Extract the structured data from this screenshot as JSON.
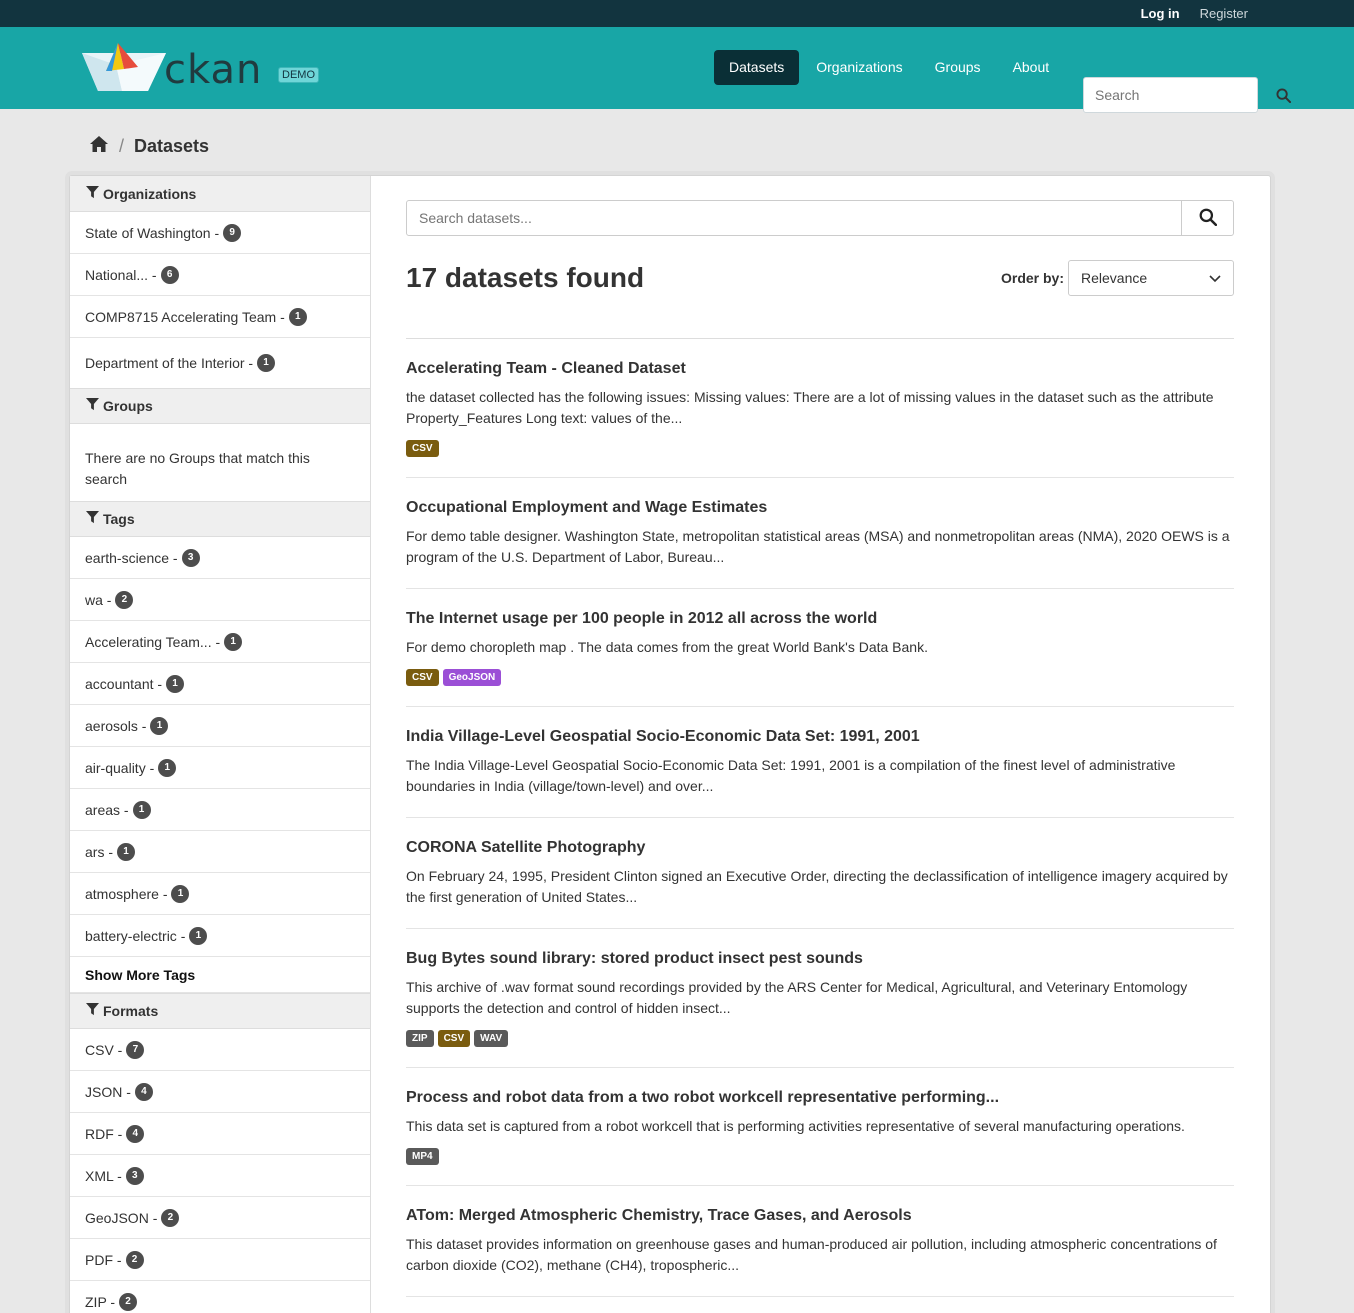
{
  "account": {
    "login": "Log in",
    "register": "Register"
  },
  "brand": {
    "name": "ckan",
    "badge": "DEMO"
  },
  "nav": {
    "items": [
      {
        "label": "Datasets",
        "active": true
      },
      {
        "label": "Organizations"
      },
      {
        "label": "Groups"
      },
      {
        "label": "About"
      }
    ],
    "search_placeholder": "Search"
  },
  "breadcrumb": {
    "current": "Datasets",
    "separator": "/"
  },
  "sidebar": {
    "organizations": {
      "heading": "Organizations",
      "items": [
        {
          "label": "State of Washington -",
          "count": "9"
        },
        {
          "label": "National... -",
          "count": "6"
        },
        {
          "label": "COMP8715 Accelerating Team -",
          "count": "1"
        },
        {
          "label": "Department of the Interior -",
          "count": "1"
        }
      ]
    },
    "groups": {
      "heading": "Groups",
      "empty": "There are no Groups that match this search"
    },
    "tags": {
      "heading": "Tags",
      "items": [
        {
          "label": "earth-science -",
          "count": "3"
        },
        {
          "label": "wa -",
          "count": "2"
        },
        {
          "label": "Accelerating Team... -",
          "count": "1"
        },
        {
          "label": "accountant -",
          "count": "1"
        },
        {
          "label": "aerosols -",
          "count": "1"
        },
        {
          "label": "air-quality -",
          "count": "1"
        },
        {
          "label": "areas -",
          "count": "1"
        },
        {
          "label": "ars -",
          "count": "1"
        },
        {
          "label": "atmosphere -",
          "count": "1"
        },
        {
          "label": "battery-electric -",
          "count": "1"
        }
      ],
      "show_more": "Show More Tags"
    },
    "formats": {
      "heading": "Formats",
      "items": [
        {
          "label": "CSV -",
          "count": "7"
        },
        {
          "label": "JSON -",
          "count": "4"
        },
        {
          "label": "RDF -",
          "count": "4"
        },
        {
          "label": "XML -",
          "count": "3"
        },
        {
          "label": "GeoJSON -",
          "count": "2"
        },
        {
          "label": "PDF -",
          "count": "2"
        },
        {
          "label": "ZIP -",
          "count": "2"
        }
      ]
    }
  },
  "main": {
    "search_placeholder": "Search datasets...",
    "results_title": "17 datasets found",
    "order_by_label": "Order by:",
    "order_by_value": "Relevance",
    "format_colors": {
      "CSV": "#7a5c0f",
      "GeoJSON": "#9b4fd6",
      "ZIP": "#5a5a5a",
      "WAV": "#5a5a5a",
      "MP4": "#5a5a5a"
    },
    "datasets": [
      {
        "title": "Accelerating Team - Cleaned Dataset",
        "notes": "the dataset collected has the following issues: Missing values: There are a lot of missing values in the dataset such as the attribute Property_Features Long text: values of the...",
        "formats": [
          "CSV"
        ]
      },
      {
        "title": "Occupational Employment and Wage Estimates",
        "notes": "For demo table designer. Washington State, metropolitan statistical areas (MSA) and nonmetropolitan areas (NMA), 2020 OEWS is a program of the U.S. Department of Labor, Bureau...",
        "formats": []
      },
      {
        "title": "The Internet usage per 100 people in 2012 all across the world",
        "notes": "For demo choropleth map . The data comes from the great World Bank's Data Bank.",
        "formats": [
          "CSV",
          "GeoJSON"
        ]
      },
      {
        "title": "India Village-Level Geospatial Socio-Economic Data Set: 1991, 2001",
        "notes": "The India Village-Level Geospatial Socio-Economic Data Set: 1991, 2001 is a compilation of the finest level of administrative boundaries in India (village/town-level) and over...",
        "formats": []
      },
      {
        "title": "CORONA Satellite Photography",
        "notes": "On February 24, 1995, President Clinton signed an Executive Order, directing the declassification of intelligence imagery acquired by the first generation of United States...",
        "formats": []
      },
      {
        "title": "Bug Bytes sound library: stored product insect pest sounds",
        "notes": "This archive of .wav format sound recordings provided by the ARS Center for Medical, Agricultural, and Veterinary Entomology supports the detection and control of hidden insect...",
        "formats": [
          "ZIP",
          "CSV",
          "WAV"
        ]
      },
      {
        "title": "Process and robot data from a two robot workcell representative performing...",
        "notes": "This data set is captured from a robot workcell that is performing activities representative of several manufacturing operations.",
        "formats": [
          "MP4"
        ]
      },
      {
        "title": "ATom: Merged Atmospheric Chemistry, Trace Gases, and Aerosols",
        "notes": "This dataset provides information on greenhouse gases and human-produced air pollution, including atmospheric concentrations of carbon dioxide (CO2), methane (CH4), tropospheric...",
        "formats": []
      }
    ]
  }
}
